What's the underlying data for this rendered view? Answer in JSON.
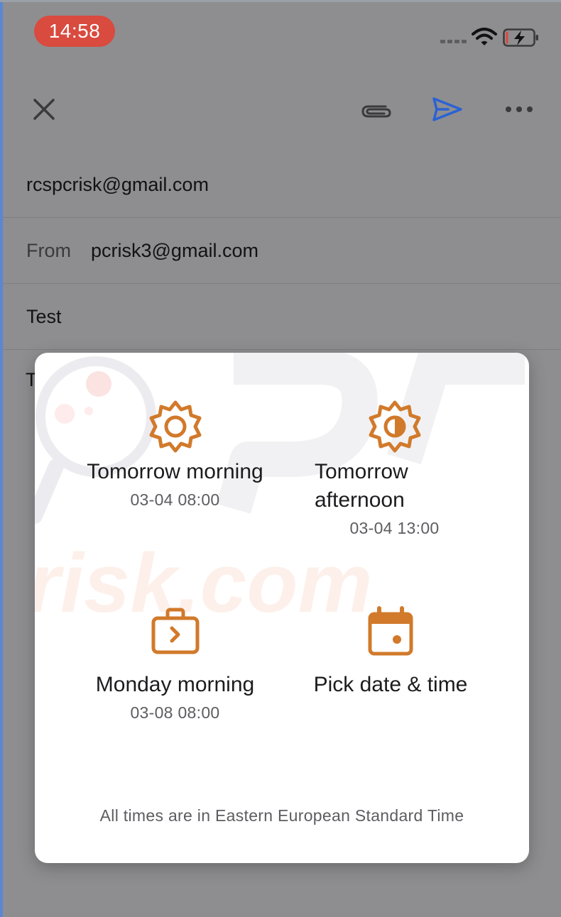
{
  "status_bar": {
    "time": "14:58"
  },
  "toolbar": {
    "close_icon": "close-icon",
    "attach_icon": "paperclip-icon",
    "send_icon": "send-icon",
    "more_icon": "more-horizontal-icon",
    "send_color": "#2b62d4"
  },
  "compose": {
    "to": "rcspcrisk@gmail.com",
    "from_label": "From",
    "from": "pcrisk3@gmail.com",
    "subject": "Test",
    "body_peek": "T"
  },
  "schedule_send": {
    "accent_color": "#d17a2b",
    "options": [
      {
        "title": "Tomorrow morning",
        "date": "03-04 08:00",
        "icon": "sun-icon"
      },
      {
        "title": "Tomorrow afternoon",
        "date": "03-04 13:00",
        "icon": "half-sun-icon"
      },
      {
        "title": "Monday morning",
        "date": "03-08 08:00",
        "icon": "briefcase-icon"
      },
      {
        "title": "Pick date & time",
        "date": "",
        "icon": "calendar-icon"
      }
    ],
    "footnote": "All times are in Eastern European Standard Time"
  }
}
